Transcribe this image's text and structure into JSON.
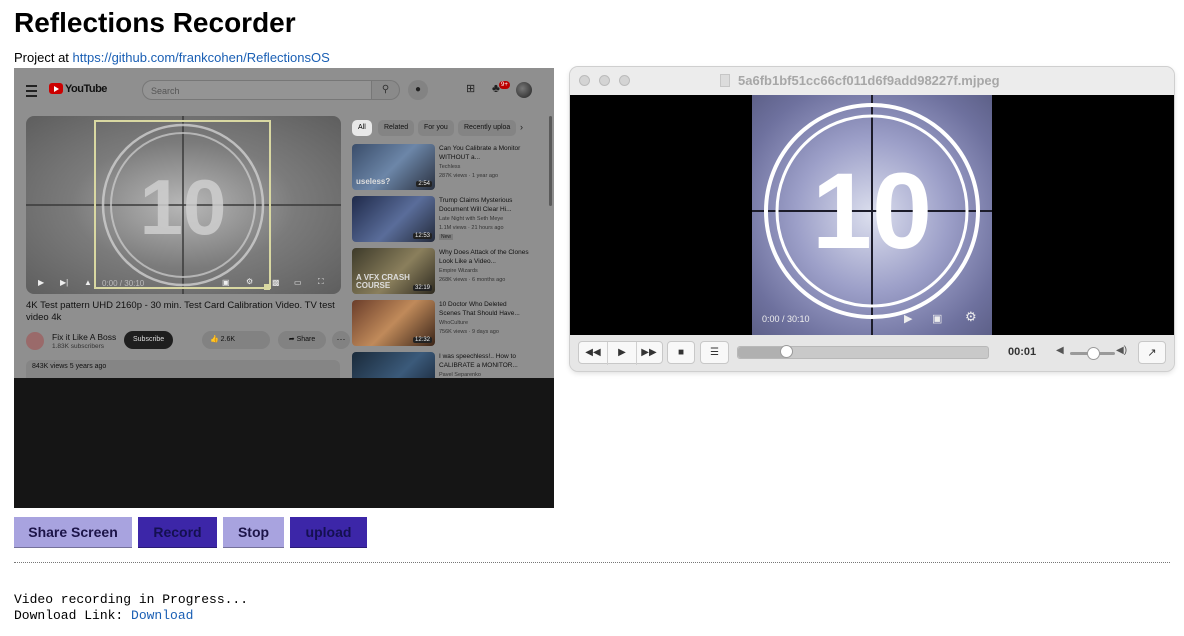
{
  "page": {
    "title": "Reflections Recorder",
    "project_prefix": "Project at",
    "project_link": "https://github.com/frankcohen/ReflectionsOS"
  },
  "preview": {
    "youtube": {
      "logo_text": "YouTube",
      "search_placeholder": "Search",
      "notification_count": "9+",
      "player_time": "0:00 / 30:10",
      "countdown_number": "10",
      "video_title": "4K Test pattern UHD 2160p - 30 min. Test Card Calibration Video. TV test video 4k",
      "channel_name": "Fix it Like A Boss",
      "channel_subs": "1.83K subscribers",
      "subscribe_label": "Subscribe",
      "like_count": "2.6K",
      "share_label": "Share",
      "more_label": "···",
      "description_meta": "843K views  5 years ago",
      "chips": [
        "All",
        "Related",
        "For you",
        "Recently uploa"
      ],
      "recommendations": [
        {
          "title": "Can You Calibrate a Monitor WITHOUT a...",
          "channel": "Techless",
          "meta": "287K views · 1 year ago",
          "duration": "2:54",
          "thumb_text": "useless?",
          "badge": ""
        },
        {
          "title": "Trump Claims Mysterious Document Will Clear Hi...",
          "channel": "Late Night with Seth Meye",
          "meta": "1.1M views · 21 hours ago",
          "duration": "12:53",
          "thumb_text": "",
          "badge": "New"
        },
        {
          "title": "Why Does Attack of the Clones Look Like a Video...",
          "channel": "Empire Wizards",
          "meta": "268K views · 6 months ago",
          "duration": "32:19",
          "thumb_text": "A VFX CRASH COURSE",
          "badge": ""
        },
        {
          "title": "10 Doctor Who Deleted Scenes That Should Have...",
          "channel": "WhoCulture",
          "meta": "756K views · 9 days ago",
          "duration": "12:32",
          "thumb_text": "",
          "badge": ""
        },
        {
          "title": "I was speechless!.. How to CALIBRATE a MONITOR...",
          "channel": "Pavel Separenko",
          "meta": "",
          "duration": "",
          "thumb_text": "HOW TO CALIBRATE",
          "badge": ""
        }
      ]
    }
  },
  "player": {
    "filename": "5a6fb1bf51cc66cf011d6f9add98227f.mjpeg",
    "countdown_number": "10",
    "overlay_time": "0:00 / 30:10",
    "current_time": "00:01",
    "seek_fraction": 0.19,
    "volume_fraction": 0.5,
    "icons": {
      "rewind": "rewind-icon",
      "play": "play-icon",
      "fast_forward": "fast-forward-icon",
      "stop": "stop-icon",
      "playlist": "playlist-icon",
      "fullscreen": "fullscreen-icon"
    }
  },
  "buttons": {
    "share_screen": "Share Screen",
    "record": "Record",
    "stop": "Stop",
    "upload": "upload"
  },
  "status": {
    "message": "Video recording in Progress...",
    "download_prefix": "Download Link:",
    "download_link": "Download"
  },
  "colors": {
    "light_button": "#a8a3df",
    "dark_button": "#3c26a8",
    "link": "#1a5fb4"
  }
}
